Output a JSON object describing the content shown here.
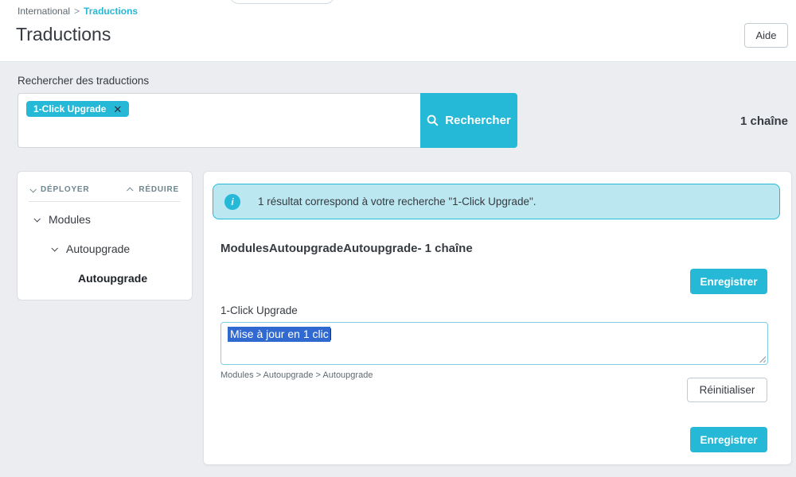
{
  "header": {
    "breadcrumb": {
      "parent": "International",
      "separator": ">",
      "current": "Traductions"
    },
    "title": "Traductions",
    "help_button": "Aide"
  },
  "search": {
    "label": "Rechercher des traductions",
    "tag": "1-Click Upgrade",
    "tag_remove_icon": "✕",
    "button": "Rechercher",
    "count": "1 chaîne"
  },
  "sidebar": {
    "expand_label": "DÉPLOYER",
    "collapse_label": "RÉDUIRE",
    "tree": [
      {
        "label": "Modules"
      },
      {
        "label": "Autoupgrade"
      },
      {
        "label": "Autoupgrade"
      }
    ]
  },
  "main": {
    "alert_icon": "i",
    "alert_text": "1 résultat correspond à votre recherche \"1-Click Upgrade\".",
    "section_title": "ModulesAutoupgradeAutoupgrade- 1 chaîne",
    "save_button_top": "Enregistrer",
    "field": {
      "label": "1-Click Upgrade",
      "value": "Mise à jour en 1 clic",
      "path": "Modules > Autoupgrade > Autoupgrade",
      "reset_button": "Réinitialiser"
    },
    "save_button_bottom": "Enregistrer"
  },
  "colors": {
    "accent": "#25b9d7",
    "alert_background": "#bbe7f0",
    "selection_blue": "#3069d0",
    "page_background": "#ebedf0"
  }
}
